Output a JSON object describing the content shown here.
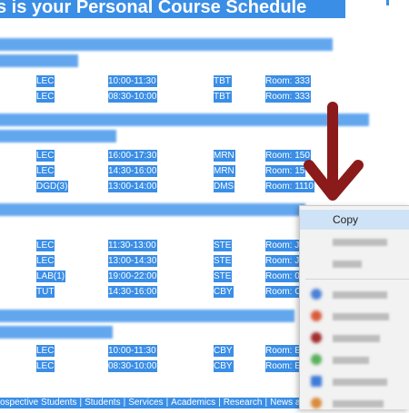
{
  "title": "s is your Personal Course Schedule",
  "courses": [
    {
      "rows": [
        {
          "type": "LEC",
          "time": "10:00-11:30",
          "building": "TBT",
          "room": "Room: 333"
        },
        {
          "type": "LEC",
          "time": "08:30-10:00",
          "building": "TBT",
          "room": "Room: 333"
        }
      ]
    },
    {
      "rows": [
        {
          "type": "LEC",
          "time": "16:00-17:30",
          "building": "MRN",
          "room": "Room: 150"
        },
        {
          "type": "LEC",
          "time": "14:30-16:00",
          "building": "MRN",
          "room": "Room: 15"
        },
        {
          "type": "DGD(3)",
          "time": "13:00-14:00",
          "building": "DMS",
          "room": "Room: 1110"
        }
      ]
    },
    {
      "rows": [
        {
          "type": "LEC",
          "time": "11:30-13:00",
          "building": "STE",
          "room": "Room: J"
        },
        {
          "type": "LEC",
          "time": "13:00-14:30",
          "building": "STE",
          "room": "Room: J"
        },
        {
          "type": "LAB(1)",
          "time": "19:00-22:00",
          "building": "STE",
          "room": "Room: 0"
        },
        {
          "type": "TUT",
          "time": "14:30-16:00",
          "building": "CBY",
          "room": "Room: C"
        }
      ]
    },
    {
      "rows": [
        {
          "type": "LEC",
          "time": "10:00-11:30",
          "building": "CBY",
          "room": "Room: E"
        },
        {
          "type": "LEC",
          "time": "08:30-10:00",
          "building": "CBY",
          "room": "Room: E"
        }
      ]
    }
  ],
  "footer": {
    "links": [
      "ospective Students",
      "Students",
      "Services",
      "Academics",
      "Research",
      "News an"
    ]
  },
  "context_menu": {
    "copy_label": "Copy",
    "accent": "#cfe3f7"
  },
  "colors": {
    "selection": "#3a8ee6",
    "arrow": "#8b1a1a"
  }
}
